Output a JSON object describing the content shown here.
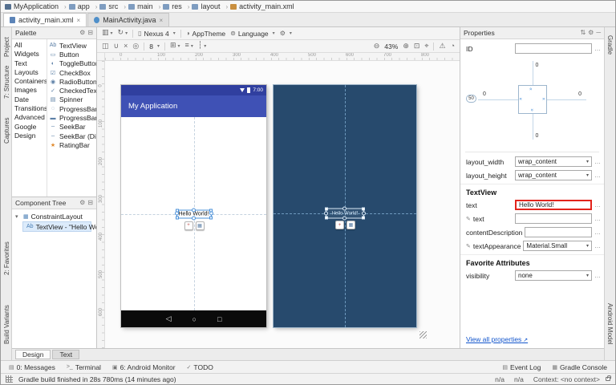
{
  "window": {
    "breadcrumbs": [
      "MyApplication",
      "app",
      "src",
      "main",
      "res",
      "layout",
      "activity_main.xml"
    ],
    "editor_tabs": [
      {
        "label": "activity_main.xml",
        "close": "×"
      },
      {
        "label": "MainActivity.java",
        "close": "×"
      }
    ]
  },
  "left_strip": {
    "items": [
      "Project",
      "7: Structure",
      "Captures",
      "2: Favorites",
      "Build Variants"
    ]
  },
  "right_strip": {
    "items": [
      "Gradle",
      "Android Model"
    ]
  },
  "palette": {
    "title": "Palette",
    "header_icons": [
      {
        "name": "gear-icon",
        "glyph": "⚙"
      },
      {
        "name": "collapse-all-icon",
        "glyph": "⊟"
      }
    ],
    "categories": [
      "All",
      "Widgets",
      "Text",
      "Layouts",
      "Containers",
      "Images",
      "Date",
      "Transitions",
      "Advanced",
      "Google",
      "Design"
    ],
    "widgets": [
      {
        "icon": "Ab",
        "label": "TextView"
      },
      {
        "icon": "▭",
        "label": "Button"
      },
      {
        "icon": "◐",
        "label": "ToggleButton"
      },
      {
        "icon": "☑",
        "label": "CheckBox"
      },
      {
        "icon": "◉",
        "label": "RadioButton"
      },
      {
        "icon": "✓",
        "label": "CheckedTextView"
      },
      {
        "icon": "▤",
        "label": "Spinner"
      },
      {
        "icon": "◌",
        "label": "ProgressBar"
      },
      {
        "icon": "▬",
        "label": "ProgressBar (Horizontal)"
      },
      {
        "icon": "╌",
        "label": "SeekBar"
      },
      {
        "icon": "╌",
        "label": "SeekBar (Discrete)"
      },
      {
        "icon": "★",
        "label": "RatingBar"
      }
    ]
  },
  "component_tree": {
    "title": "Component Tree",
    "header_icons": [
      {
        "name": "gear-icon",
        "glyph": "⚙"
      },
      {
        "name": "expand-all-icon",
        "glyph": "⊟"
      }
    ],
    "rows": [
      {
        "twisty": "▾",
        "icon": "▦",
        "label": "ConstraintLayout"
      },
      {
        "twisty": "",
        "icon": "Ab",
        "label": "TextView - \"Hello Wo"
      }
    ]
  },
  "design_toolbar": {
    "surface_icons": [
      {
        "name": "design-surface-mode-icon",
        "glyph": "▥"
      },
      {
        "name": "orientation-icon",
        "glyph": "↻"
      }
    ],
    "device": "Nexus 4",
    "theme": "AppTheme",
    "language": "Language",
    "edit_icons": [
      {
        "name": "show-constraints-icon",
        "glyph": "◫"
      },
      {
        "name": "autoconnect-icon",
        "glyph": "∪"
      },
      {
        "name": "clear-all-constraints-icon",
        "glyph": "×"
      },
      {
        "name": "infer-constraints-icon",
        "glyph": "◎"
      }
    ],
    "default_margin": "8",
    "pack_icons": [
      {
        "name": "pack-selection-icon",
        "glyph": "⊞"
      },
      {
        "name": "align-icon",
        "glyph": "≡"
      },
      {
        "name": "guideline-icon",
        "glyph": "┆"
      }
    ],
    "zoom_out_icon": "⊖",
    "zoom": "43%",
    "zoom_in_icon": "⊕",
    "zoom_icons": [
      {
        "name": "zoom-to-fit-icon",
        "glyph": "⊡"
      },
      {
        "name": "pan-icon",
        "glyph": "⌖"
      }
    ],
    "alert_icons": [
      {
        "name": "warning-icon",
        "glyph": "⚠"
      },
      {
        "name": "notifications-bell-icon",
        "glyph": "◔"
      }
    ]
  },
  "canvas": {
    "ruler_top": [
      "0",
      "100",
      "200",
      "300",
      "400",
      "500",
      "600",
      "700",
      "800"
    ],
    "ruler_left": [
      "0",
      "100",
      "200",
      "300",
      "400",
      "500",
      "600"
    ],
    "device": {
      "status_time": "7:00",
      "app_title": "My Application",
      "text": "Hello World!",
      "nav_icons": [
        {
          "name": "back-icon",
          "glyph": "◁"
        },
        {
          "name": "home-icon",
          "glyph": "○"
        },
        {
          "name": "recents-icon",
          "glyph": "□"
        }
      ]
    },
    "chips": [
      {
        "name": "constraint-action-chip-1",
        "glyph": "+"
      },
      {
        "name": "constraint-action-chip-2",
        "glyph": "▦"
      }
    ]
  },
  "properties": {
    "title": "Properties",
    "header_icons": [
      {
        "name": "sort-icon",
        "glyph": "⇅"
      },
      {
        "name": "gear-icon",
        "glyph": "⚙"
      },
      {
        "name": "minimize-icon",
        "glyph": "─"
      }
    ],
    "id_label": "ID",
    "id_value": "",
    "inspector": {
      "margin_top": "0",
      "margin_left": "0",
      "margin_right": "0",
      "margin_bottom": "0",
      "vertical_bias": "50"
    },
    "layout_width": {
      "label": "layout_width",
      "value": "wrap_content"
    },
    "layout_height": {
      "label": "layout_height",
      "value": "wrap_content"
    },
    "section_textview": "TextView",
    "text": {
      "label": "text",
      "value": "Hello World!"
    },
    "text_design": {
      "label": "text",
      "value": ""
    },
    "content_description": {
      "label": "contentDescription",
      "value": ""
    },
    "text_appearance": {
      "label": "textAppearance",
      "value": "Material.Small"
    },
    "section_favorites": "Favorite Attributes",
    "visibility": {
      "label": "visibility",
      "value": "none"
    },
    "view_all": "View all properties"
  },
  "bottom_tabs": [
    {
      "label": "Design"
    },
    {
      "label": "Text"
    }
  ],
  "tool_windows": {
    "left": [
      {
        "icon": "▤",
        "label": "0: Messages"
      },
      {
        "icon": ">_",
        "label": "Terminal"
      },
      {
        "icon": "▣",
        "label": "6: Android Monitor"
      },
      {
        "icon": "✓",
        "label": "TODO"
      }
    ],
    "right": [
      {
        "icon": "▤",
        "label": "Event Log"
      },
      {
        "icon": "▦",
        "label": "Gradle Console"
      }
    ]
  },
  "status_bar": {
    "message": "Gradle build finished in 28s 780ms (14 minutes ago)",
    "right": [
      "n/a",
      "n/a",
      "Context: <no context>"
    ]
  },
  "colors": {
    "app_bar": "#3F51B5",
    "phone_status_bar": "#303F9F",
    "blueprint_background": "#274a6d",
    "selection_blue": "#4a90d9",
    "highlight_red": "#e2241c"
  }
}
